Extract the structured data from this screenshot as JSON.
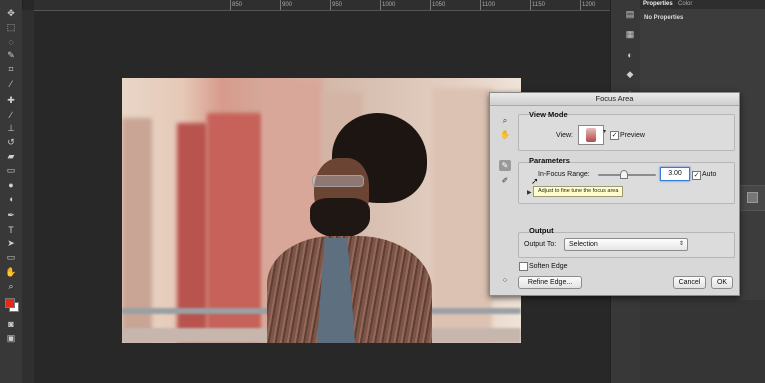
{
  "ruler": {
    "ticks": [
      "850",
      "900",
      "950",
      "1000",
      "1050",
      "1100",
      "1150",
      "1200"
    ]
  },
  "panels": {
    "tab_properties": "Properties",
    "tab_color": "Color",
    "empty_text": "No Properties"
  },
  "dialog": {
    "title": "Focus Area",
    "view_mode": {
      "heading": "View Mode",
      "view_label": "View:",
      "preview_label": "Preview",
      "preview_checked": true
    },
    "parameters": {
      "heading": "Parameters",
      "range_label": "In-Focus Range:",
      "range_value": "3.00",
      "auto_label": "Auto",
      "auto_checked": true,
      "slider_fraction": 0.43
    },
    "tooltip": "Adjust to fine tune the focus area",
    "output": {
      "heading": "Output",
      "output_to_label": "Output To:",
      "output_to_value": "Selection"
    },
    "soften_edge_label": "Soften Edge",
    "soften_edge_checked": false,
    "buttons": {
      "refine_edge": "Refine Edge...",
      "cancel": "Cancel",
      "ok": "OK"
    }
  },
  "colors": {
    "foreground": "#e02a1c",
    "background": "#ffffff"
  }
}
